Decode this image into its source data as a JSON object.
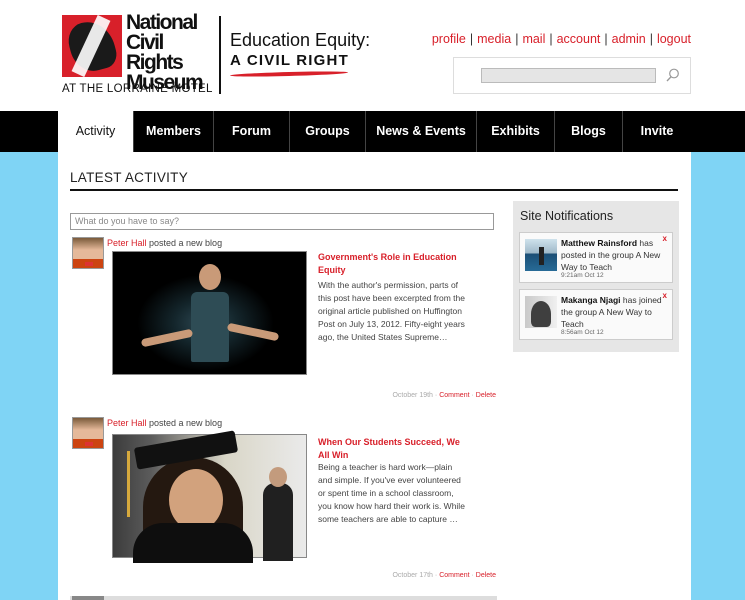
{
  "brand": {
    "logo_line1": "National",
    "logo_line2": "Civil Rights",
    "logo_line3": "Museum",
    "tagline": "AT THE LORRAINE MOTEL",
    "campaign_title": "Education Equity:",
    "campaign_subtitle": "A CIVIL RIGHT"
  },
  "toplinks": [
    "profile",
    "media",
    "mail",
    "account",
    "admin",
    "logout"
  ],
  "search": {
    "placeholder": "",
    "icon": "search-icon"
  },
  "nav": {
    "items": [
      {
        "label": "Activity",
        "active": true
      },
      {
        "label": "Members",
        "active": false
      },
      {
        "label": "Forum",
        "active": false
      },
      {
        "label": "Groups",
        "active": false
      },
      {
        "label": "News & Events",
        "active": false
      },
      {
        "label": "Exhibits",
        "active": false
      },
      {
        "label": "Blogs",
        "active": false
      },
      {
        "label": "Invite",
        "active": false
      }
    ]
  },
  "main": {
    "heading": "LATEST ACTIVITY",
    "composer_placeholder": "What do you have to say?",
    "activities": [
      {
        "user": "Peter Hall",
        "action": " posted a new blog",
        "title": "Government's Role in Education Equity",
        "excerpt": "With the author's permission, parts of this post have been excerpted from the original article published on Huffington Post on July 13, 2012. Fifty-eight years ago, the United States Supreme…",
        "date": "October 19th",
        "comment": "Comment",
        "delete": "Delete"
      },
      {
        "user": "Peter Hall",
        "action": " posted a new blog",
        "title": "When Our Students Succeed, We All Win",
        "excerpt": "Being a teacher is hard work—plain and simple. If you've ever volunteered or spent time in a school classroom, you know how hard their work is. While some teachers are able to capture …",
        "date": "October 17th",
        "comment": "Comment",
        "delete": "Delete"
      }
    ]
  },
  "sidebar": {
    "title": "Site Notifications",
    "notifications": [
      {
        "name": "Matthew Rainsford",
        "text": " has posted in the group A New Way to Teach",
        "time": "9:21am Oct 12",
        "close": "x"
      },
      {
        "name": "Makanga Njagi",
        "text": " has joined the group A New Way to Teach",
        "time": "8:56am Oct 12",
        "close": "x"
      }
    ]
  },
  "colors": {
    "accent": "#d8202a",
    "background": "#7fd4f5",
    "nav": "#000000"
  }
}
